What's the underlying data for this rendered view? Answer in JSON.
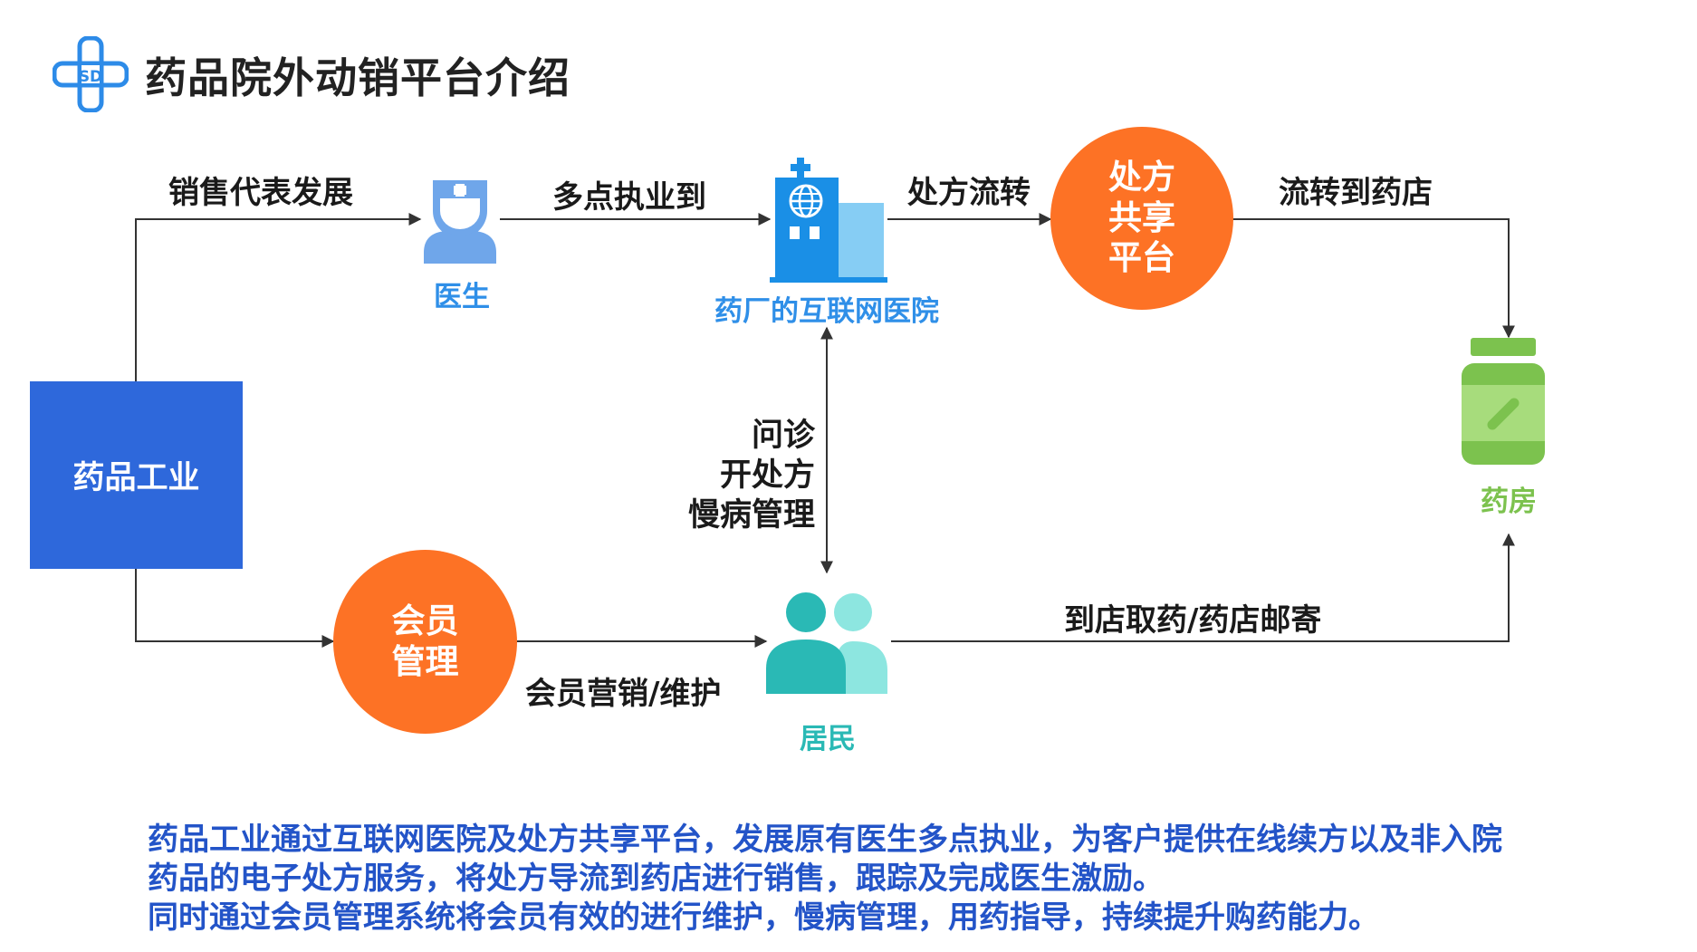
{
  "title": "药品院外动销平台介绍",
  "icons": {
    "logo": "logo-cross-icon",
    "doctor": "doctor-icon",
    "hospital": "hospital-building-icon",
    "pharmacy": "medicine-bottle-icon",
    "residents": "people-icon"
  },
  "colors": {
    "blue_box": "#2e68db",
    "orange": "#fd7225",
    "doctor_blue": "#2f8fe8",
    "pharmacy_green": "#7cc24e",
    "resident_teal": "#2ab9b5",
    "footer_text": "#2354c8"
  },
  "nodes": {
    "industry": "药品工业",
    "doctor": "医生",
    "hospital": "药厂的互联网医院",
    "platform": [
      "处方",
      "共享",
      "平台"
    ],
    "pharmacy": "药房",
    "member": [
      "会员",
      "管理"
    ],
    "residents": "居民"
  },
  "edges": {
    "sales_rep": "销售代表发展",
    "multi_site": "多点执业到",
    "rx_flow": "处方流转",
    "to_pharmacy": "流转到药店",
    "consult": [
      "问诊",
      "开处方",
      "慢病管理"
    ],
    "member_marketing": "会员营销/维护",
    "pickup_mail": "到店取药/药店邮寄"
  },
  "footer": [
    "药品工业通过互联网医院及处方共享平台，发展原有医生多点执业，为客户提供在线续方以及非入院",
    "药品的电子处方服务，将处方导流到药店进行销售，跟踪及完成医生激励。",
    "同时通过会员管理系统将会员有效的进行维护，慢病管理，用药指导，持续提升购药能力。"
  ]
}
